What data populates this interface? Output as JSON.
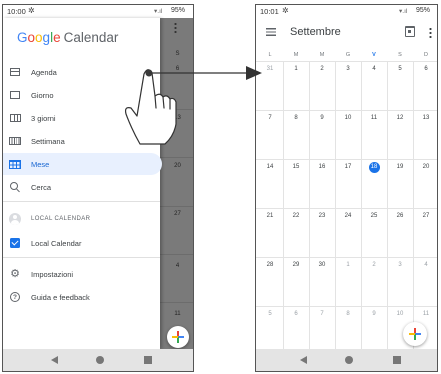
{
  "left_screen": {
    "status": {
      "time": "10:00",
      "signal": "⎘.ıl",
      "battery": "95%"
    },
    "drawer": {
      "brand": {
        "g1": "G",
        "g2": "o",
        "g3": "o",
        "g4": "g",
        "g5": "l",
        "g6": "e",
        "app": "Calendar"
      },
      "items": [
        {
          "label": "Agenda",
          "icon": "agenda-icon"
        },
        {
          "label": "Giorno",
          "icon": "day-view-icon"
        },
        {
          "label": "3 giorni",
          "icon": "three-day-view-icon"
        },
        {
          "label": "Settimana",
          "icon": "week-view-icon"
        },
        {
          "label": "Mese",
          "icon": "month-view-icon",
          "selected": true
        },
        {
          "label": "Cerca",
          "icon": "search-icon"
        }
      ],
      "account_label": "LOCAL CALENDAR",
      "calendar_item": "Local Calendar",
      "settings": "Impostazioni",
      "help": "Guida e feedback"
    },
    "backdrop_text": [
      "S",
      "6",
      "13",
      "20",
      "27",
      "4",
      "11"
    ]
  },
  "right_screen": {
    "status": {
      "time": "10:01",
      "signal": "⎘.ıl",
      "battery": "95%"
    },
    "month_title": "Settembre",
    "weekdays": [
      "L",
      "M",
      "M",
      "G",
      "V",
      "S",
      "D"
    ],
    "today_weekday_index": 4,
    "weeks": [
      [
        "31",
        "1",
        "2",
        "3",
        "4",
        "5",
        "6"
      ],
      [
        "7",
        "8",
        "9",
        "10",
        "11",
        "12",
        "13"
      ],
      [
        "14",
        "15",
        "16",
        "17",
        "18",
        "19",
        "20"
      ],
      [
        "21",
        "22",
        "23",
        "24",
        "25",
        "26",
        "27"
      ],
      [
        "28",
        "29",
        "30",
        "1",
        "2",
        "3",
        "4"
      ],
      [
        "5",
        "6",
        "7",
        "8",
        "9",
        "10",
        "11"
      ]
    ],
    "today": {
      "week": 2,
      "day": 4
    },
    "other_month_cells": [
      [
        0,
        0
      ],
      [
        4,
        3
      ],
      [
        4,
        4
      ],
      [
        4,
        5
      ],
      [
        4,
        6
      ],
      [
        5,
        0
      ],
      [
        5,
        1
      ],
      [
        5,
        2
      ],
      [
        5,
        3
      ],
      [
        5,
        4
      ],
      [
        5,
        5
      ],
      [
        5,
        6
      ]
    ]
  },
  "colors": {
    "accent": "#1a73e8",
    "selected_bg": "#e8f0fe",
    "backdrop": "#7a7a7a",
    "navbar": "#e4e4e4"
  }
}
